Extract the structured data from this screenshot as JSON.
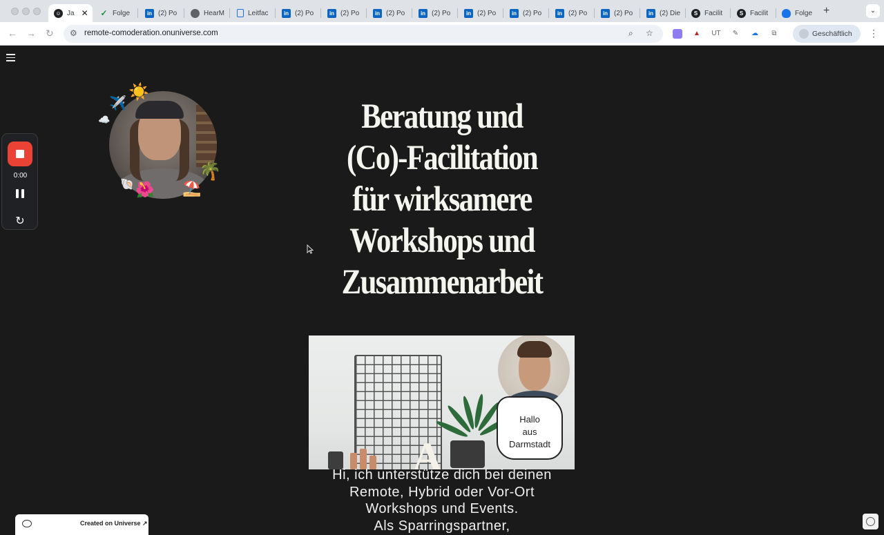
{
  "browser": {
    "tabs": [
      {
        "label": "Ja",
        "icon": "smiley-icon",
        "active": true
      },
      {
        "label": "Folge",
        "icon": "check-icon"
      },
      {
        "label": "(2) Po",
        "icon": "linkedin-icon"
      },
      {
        "label": "HearM",
        "icon": "globe-icon"
      },
      {
        "label": "Leitfac",
        "icon": "document-icon"
      },
      {
        "label": "(2) Po",
        "icon": "linkedin-icon"
      },
      {
        "label": "(2) Po",
        "icon": "linkedin-icon"
      },
      {
        "label": "(2) Po",
        "icon": "linkedin-icon"
      },
      {
        "label": "(2) Po",
        "icon": "linkedin-icon"
      },
      {
        "label": "(2) Po",
        "icon": "linkedin-icon"
      },
      {
        "label": "(2) Po",
        "icon": "linkedin-icon"
      },
      {
        "label": "(2) Po",
        "icon": "linkedin-icon"
      },
      {
        "label": "(2) Po",
        "icon": "linkedin-icon"
      },
      {
        "label": "(2) Po",
        "icon": "linkedin-icon"
      },
      {
        "label": "(2) Die",
        "icon": "linkedin-icon"
      },
      {
        "label": "Facilit",
        "icon": "s-icon"
      },
      {
        "label": "Facilit",
        "icon": "s-icon"
      },
      {
        "label": "Folge",
        "icon": "cloud-icon"
      }
    ],
    "new_tab": "+",
    "url": "remote-comoderation.onuniverse.com",
    "profile_label": "Geschäftlich"
  },
  "recorder": {
    "time": "0:00"
  },
  "page": {
    "heading_lines": [
      "Beratung und",
      "(Co)-Facilitation",
      "für wirksamere",
      "Workshops und",
      "Zusammenarbeit"
    ],
    "video_bubble": [
      "Hallo",
      "aus",
      "Darmstadt"
    ],
    "intro_lines": [
      "Hi, ich unterstütze dich bei deinen",
      "Remote, Hybrid oder Vor-Ort",
      "Workshops und Events.",
      "Als Sparringspartner,"
    ],
    "badge_label": "Created on Universe ↗"
  },
  "colors": {
    "page_background": "#1a1a1a",
    "record_button": "#ea4335",
    "tab_strip": "#dfe3e8"
  }
}
